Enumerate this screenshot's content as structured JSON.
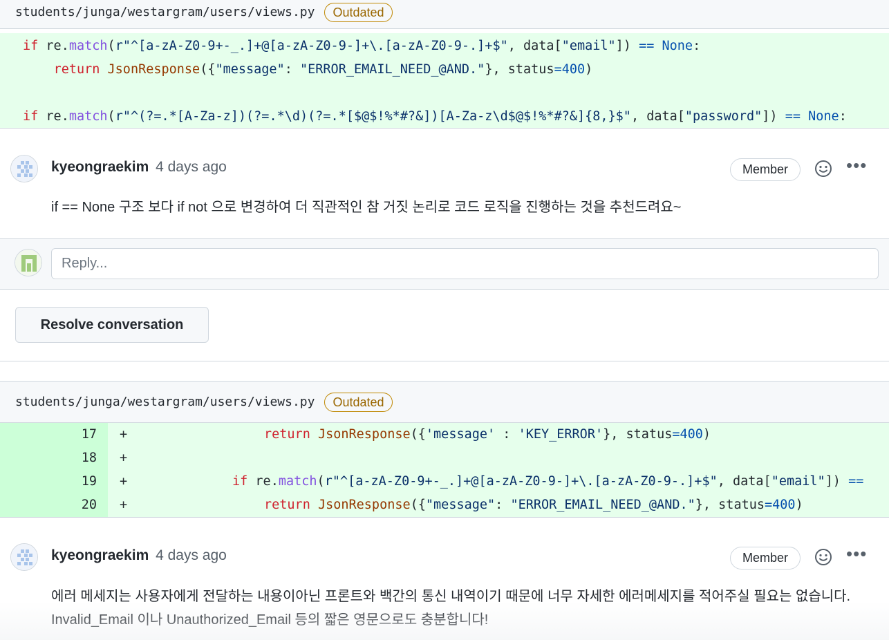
{
  "threads": [
    {
      "file_path": "students/junga/westargram/users/views.py",
      "badge": "Outdated",
      "code_lines": [
        "if re.match(r\"^[a-zA-Z0-9+-_.]+@[a-zA-Z0-9-]+\\.[a-zA-Z0-9-.]+$\", data[\"email\"]) == None:",
        "    return JsonResponse({\"message\": \"ERROR_EMAIL_NEED_@AND.\"}, status=400)",
        "",
        "if re.match(r\"^(?=.*[A-Za-z])(?=.*\\d)(?=.*[$@$!%*#?&])[A-Za-z\\d$@$!%*#?&]{8,}$\", data[\"password\"]) == None:"
      ],
      "comment": {
        "author": "kyeongraekim",
        "time": "4 days ago",
        "role": "Member",
        "body": "if == None 구조 보다 if not 으로 변경하여 더 직관적인 참 거짓 논리로 코드 로직을 진행하는 것을 추천드려요~"
      },
      "reply_placeholder": "Reply...",
      "resolve_label": "Resolve conversation"
    },
    {
      "file_path": "students/junga/westargram/users/views.py",
      "badge": "Outdated",
      "diff_lines": [
        {
          "line": "17",
          "sign": "+",
          "code": "return JsonResponse({'message' : 'KEY_ERROR'}, status=400)"
        },
        {
          "line": "18",
          "sign": "+",
          "code": ""
        },
        {
          "line": "19",
          "sign": "+",
          "code": "if re.match(r\"^[a-zA-Z0-9+-_.]+@[a-zA-Z0-9-]+\\.[a-zA-Z0-9-.]+$\", data[\"email\"]) =="
        },
        {
          "line": "20",
          "sign": "+",
          "code": "return JsonResponse({\"message\": \"ERROR_EMAIL_NEED_@AND.\"}, status=400)"
        }
      ],
      "comment": {
        "author": "kyeongraekim",
        "time": "4 days ago",
        "role": "Member",
        "body": "에러 메세지는 사용자에게 전달하는 내용이아닌 프론트와 백간의 통신 내역이기 때문에 너무 자세한 에러메세지를 적어주실 필요는 없습니다. Invalid_Email 이나 Unauthorized_Email 등의 짧은 영문으로도 충분합니다!"
      }
    }
  ],
  "icons": {
    "smiley": "smiley-icon",
    "more": "kebab-horizontal-icon",
    "avatar": "identicon-avatar"
  },
  "colors": {
    "addition_bg": "#e6ffec",
    "addition_gutter": "#ccffd8",
    "outdated_border": "#bf8700",
    "outdated_text": "#9a6700"
  }
}
